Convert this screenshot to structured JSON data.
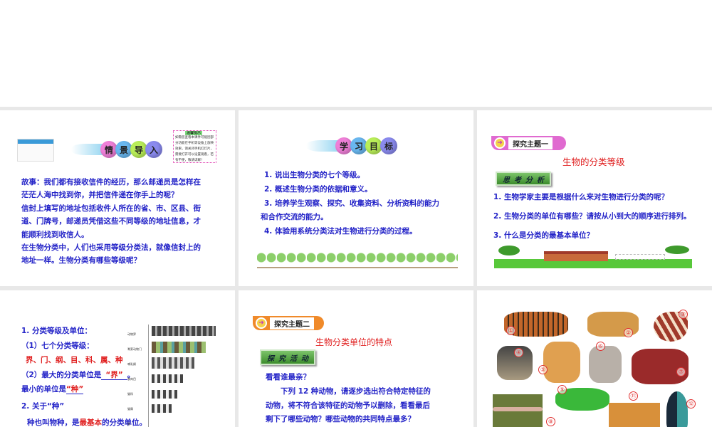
{
  "slides": [
    {
      "banner": [
        "情",
        "景",
        "导",
        "入"
      ],
      "note_title": "温馨提示",
      "note_text": "如需您查看本课件可能因部分功能在手机等设备上放映效果，请关闭手机幻灯片，需要打开可以设置观看，若有不便，敬请谅解！",
      "lines": [
        "故事：我们都有接收信件的经历，那么邮递员是怎样在",
        "茫茫人海中找到你，并把信件递在你手上的呢？",
        "信封上填写的地址包括收件人所在的省、市、区县、街",
        "道、门牌号，邮递员凭借这些不同等级的地址信息，才",
        "能顺利找到收信人。",
        "在生物分类中，人们也采用等级分类法，就像信封上的",
        "地址一样。生物分类有哪些等级呢？"
      ]
    },
    {
      "banner": [
        "学",
        "习",
        "目",
        "标"
      ],
      "lines": [
        "1. 说出生物分类的七个等级。",
        "2. 概述生物分类的依据和意义。",
        "3. 培养学生观察、探究、收集资料、分析资料的能力",
        "和合作交流的能力。",
        "4. 体验用系统分类法对生物进行分类的过程。"
      ]
    },
    {
      "tag": "探究主题一",
      "title": "生物的分类等级",
      "box": "思考分析",
      "lines": [
        "1. 生物学家主要是根据什么来对生物进行分类的呢？",
        "2. 生物分类的单位有哪些？请按从小到大的顺序进行排列。",
        "3. 什么是分类的最基本单位？"
      ]
    },
    {
      "l1": "1. 分类等级及单位：",
      "l2": "（1）七个分类等级：",
      "ranks": "界、门、纲、目、科、属、种",
      "l4a": "（2）最大的分类单位是",
      "l4b": "“界”",
      "l4c": "。",
      "l5a": "最小的单位是",
      "l5b": "“种”",
      "l6": "2. 关于“种”",
      "l7a": "种也叫物种，是",
      "l7b": "最基本",
      "l7c": "的分类单位。",
      "chart_labels": [
        "动物界",
        "脊索动物门",
        "哺乳纲",
        "食肉目",
        "猫科",
        "猫属",
        "猫"
      ]
    },
    {
      "tag": "探究主题二",
      "title": "生物分类单位的特点",
      "box": "探究活动",
      "lines": [
        "看看谁最亲？",
        "　　下列 12 种动物，请逐步选出符合特定特征的",
        "动物，将不符合该特征的动物予以删除，看看最后",
        "剩下了哪些动物？哪些动物的共同特点最多？"
      ]
    },
    {
      "animals": [
        "①",
        "②",
        "③",
        "④",
        "⑤",
        "⑥",
        "⑦",
        "⑧",
        "⑨",
        "⑪",
        "⑫"
      ]
    }
  ]
}
